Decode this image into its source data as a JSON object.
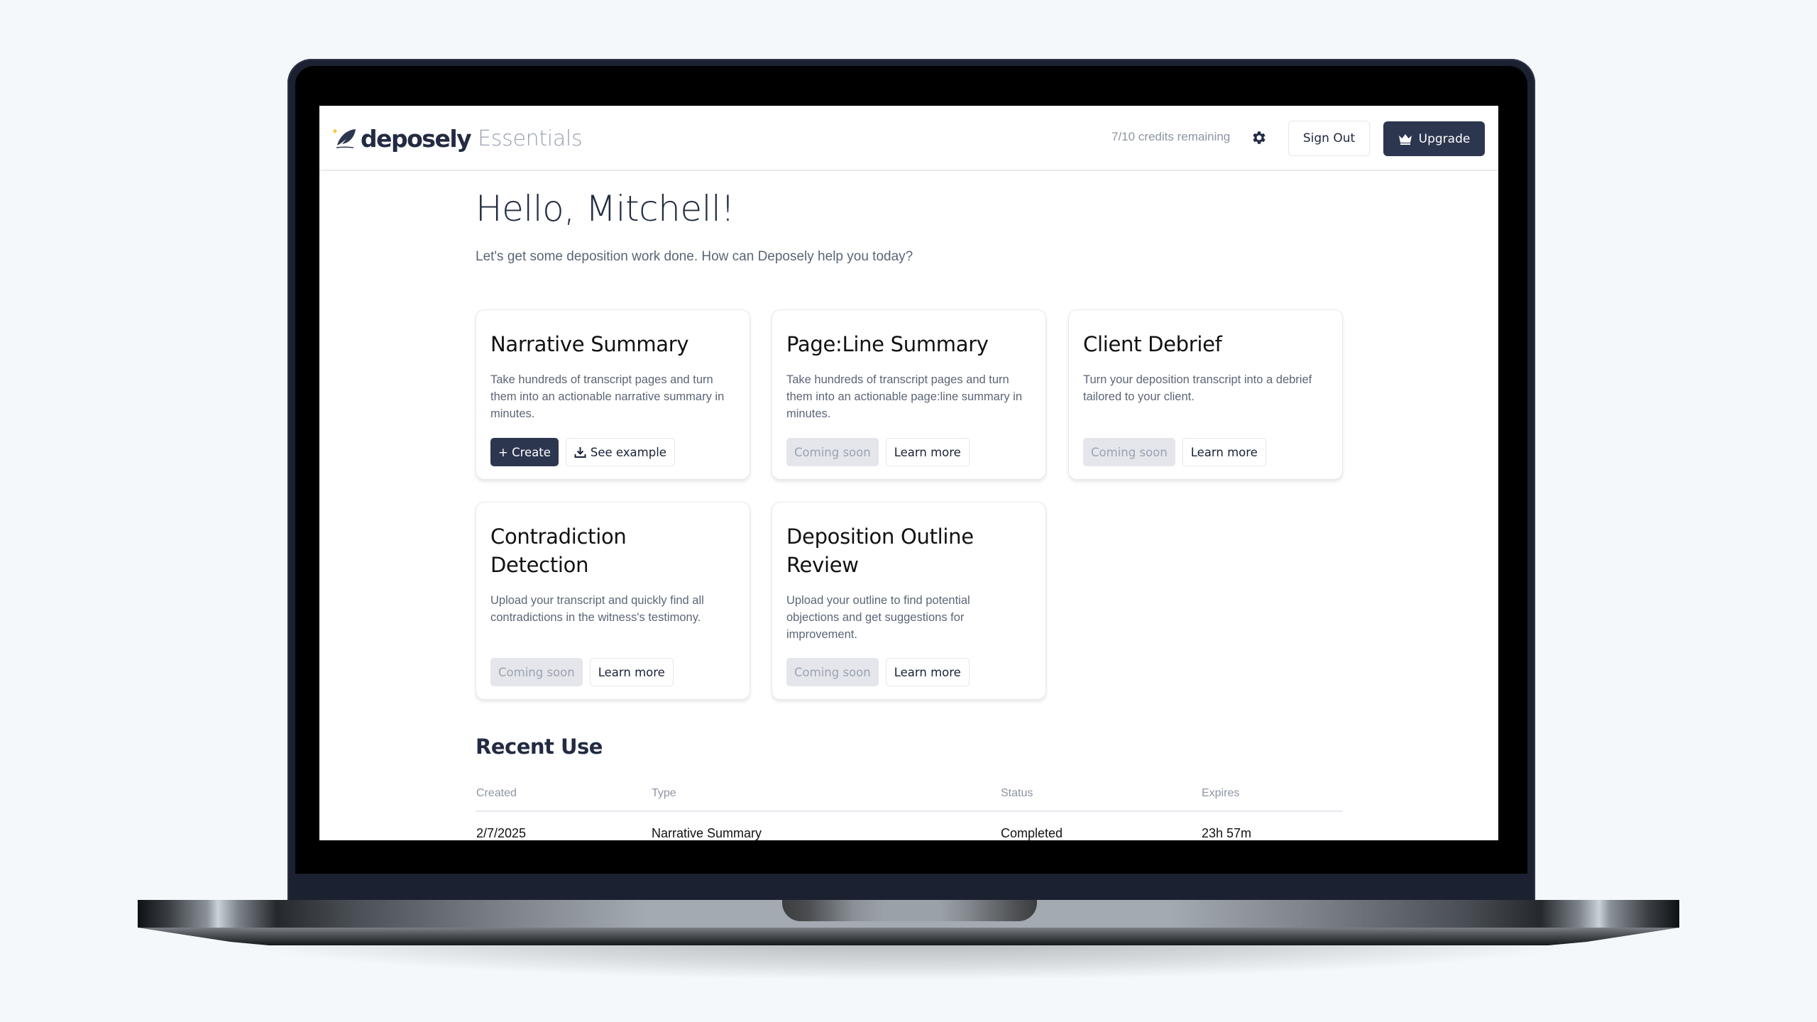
{
  "app": {
    "brand": "deposely",
    "product": "Essentials",
    "logo_icon": "feather-quill-icon"
  },
  "header": {
    "credits_text": "7/10 credits remaining",
    "settings_icon": "gear-icon",
    "sign_out_label": "Sign Out",
    "upgrade_label": "Upgrade",
    "upgrade_icon": "crown-icon"
  },
  "colors": {
    "primary": "#2d364f",
    "brand_text": "#222b42",
    "accent_star": "#f2c230",
    "muted": "#8d94a3"
  },
  "main": {
    "greeting": "Hello, Mitchell!",
    "subtitle": "Let's get some deposition work done. How can Deposely help you today?"
  },
  "cards": [
    {
      "title": "Narrative Summary",
      "description": "Take hundreds of transcript pages and turn them into an actionable narrative summary in minutes.",
      "primary_label": "+ Create",
      "secondary_label": "See example",
      "secondary_icon": "download-icon"
    },
    {
      "title": "Page:Line Summary",
      "description": "Take hundreds of transcript pages and turn them into an actionable page:line summary in minutes.",
      "status_label": "Coming soon",
      "secondary_label": "Learn more"
    },
    {
      "title": "Client Debrief",
      "description": "Turn your deposition transcript into a debrief tailored to your client.",
      "status_label": "Coming soon",
      "secondary_label": "Learn more"
    },
    {
      "title": "Contradiction Detection",
      "description": "Upload your transcript and quickly find all contradictions in the witness's testimony.",
      "status_label": "Coming soon",
      "secondary_label": "Learn more"
    },
    {
      "title": "Deposition Outline Review",
      "description": "Upload your outline to find potential objections and get suggestions for improvement.",
      "status_label": "Coming soon",
      "secondary_label": "Learn more"
    }
  ],
  "recent": {
    "title": "Recent Use",
    "columns": [
      "Created",
      "Type",
      "Status",
      "Expires"
    ],
    "rows": [
      [
        "2/7/2025",
        "Narrative Summary",
        "Completed",
        "23h 57m"
      ]
    ]
  }
}
